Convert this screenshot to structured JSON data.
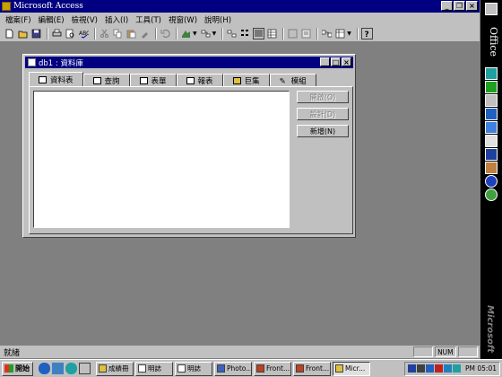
{
  "app": {
    "title": "Microsoft Access"
  },
  "menu": [
    "檔案(F)",
    "編輯(E)",
    "檢視(V)",
    "插入(I)",
    "工具(T)",
    "視窗(W)",
    "說明(H)"
  ],
  "window_controls": {
    "minimize": "_",
    "restore": "❐",
    "close": "×"
  },
  "db_window": {
    "title": "db1 : 資料庫",
    "tabs": [
      {
        "label": "資料表",
        "active": true
      },
      {
        "label": "查詢",
        "active": false
      },
      {
        "label": "表單",
        "active": false
      },
      {
        "label": "報表",
        "active": false
      },
      {
        "label": "巨集",
        "active": false
      },
      {
        "label": "模組",
        "active": false
      }
    ],
    "buttons": {
      "open": "開啟(O)",
      "design": "設計(D)",
      "new": "新增(N)"
    }
  },
  "office_bar": {
    "label": "Office",
    "brand": "Microsoft"
  },
  "statusbar": {
    "text": "就緒",
    "num": "NUM"
  },
  "taskbar": {
    "start": "開始",
    "tasks": [
      "成績冊",
      "明誌",
      "明誌",
      "Photo...",
      "Front...",
      "Front...",
      "Micr..."
    ],
    "clock": "PM 05:01"
  },
  "colors": {
    "titlebar": "#000080",
    "face": "#c0c0c0",
    "desktop": "#808080"
  }
}
